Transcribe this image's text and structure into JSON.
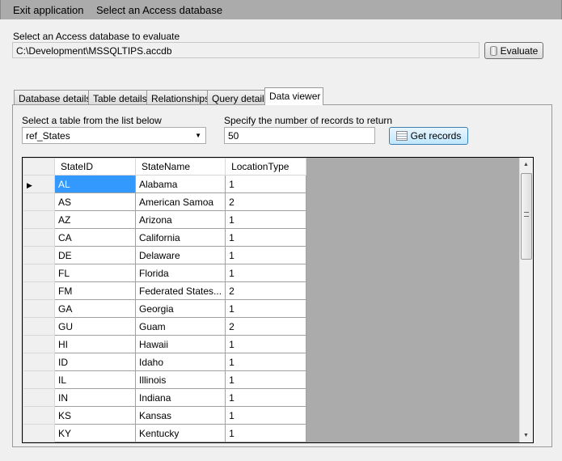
{
  "menu": {
    "exit": "Exit application",
    "select_db": "Select an Access database"
  },
  "db": {
    "label": "Select an Access database to evaluate",
    "path": "C:\\Development\\MSSQLTIPS.accdb",
    "evaluate": "Evaluate"
  },
  "tabs": [
    "Database details",
    "Table details",
    "Relationships",
    "Query details",
    "Data viewer"
  ],
  "viewer": {
    "table_label": "Select a table from the list below",
    "table_value": "ref_States",
    "records_label": "Specify the number of records to return",
    "records_value": "50",
    "get_records": "Get records"
  },
  "grid": {
    "columns": [
      "StateID",
      "StateName",
      "LocationType"
    ],
    "rows": [
      [
        "AL",
        "Alabama",
        "1"
      ],
      [
        "AS",
        "American Samoa",
        "2"
      ],
      [
        "AZ",
        "Arizona",
        "1"
      ],
      [
        "CA",
        "California",
        "1"
      ],
      [
        "DE",
        "Delaware",
        "1"
      ],
      [
        "FL",
        "Florida",
        "1"
      ],
      [
        "FM",
        "Federated States...",
        "2"
      ],
      [
        "GA",
        "Georgia",
        "1"
      ],
      [
        "GU",
        "Guam",
        "2"
      ],
      [
        "HI",
        "Hawaii",
        "1"
      ],
      [
        "ID",
        "Idaho",
        "1"
      ],
      [
        "IL",
        "Illinois",
        "1"
      ],
      [
        "IN",
        "Indiana",
        "1"
      ],
      [
        "KS",
        "Kansas",
        "1"
      ],
      [
        "KY",
        "Kentucky",
        "1"
      ]
    ]
  }
}
